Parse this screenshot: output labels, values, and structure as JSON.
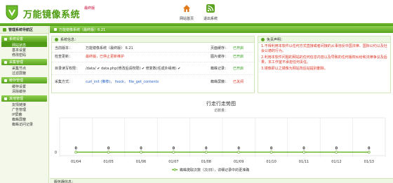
{
  "header": {
    "title": "万能镜像系统",
    "badge": "最终版",
    "nav": [
      {
        "label": "网站首页",
        "icon": "home-icon",
        "color": "#e07a1a"
      },
      {
        "label": "退出系统",
        "icon": "rss-icon",
        "color": "#5aa41f"
      }
    ]
  },
  "sidebar": {
    "title": "管理系统导航区",
    "sections": [
      {
        "title": "系统设置",
        "items": [
          "网站状态",
          "基本设置",
          "修改密码"
        ]
      },
      {
        "title": "采集管理",
        "items": [
          "采集节点",
          "过滤屏蔽"
        ]
      },
      {
        "title": "缓存管理",
        "items": [
          "缓存设置",
          "清除缓存"
        ]
      },
      {
        "title": "其他管理",
        "items": [
          "友情链接",
          "广告管理",
          "IP屏蔽",
          "蜘蛛屏蔽",
          "蜘蛛访问记录"
        ]
      }
    ],
    "active_item": "网站状态"
  },
  "breadcrumb": "万能镜像系统（最终版）6.21",
  "sysinfo": {
    "title": "系统信息：",
    "rows": [
      {
        "label": "当前版本：",
        "value": "万能镜像系统（最终版） 6.21",
        "label2": "页面缓存：",
        "status2": "已开启"
      },
      {
        "label": "检查更新：",
        "value": "最终版，已停止更新维护",
        "label2": "图片缓存：",
        "status2": "已开启"
      },
      {
        "label": "目录读写权限：",
        "value": "/data/ ✔   data.php(修改后请权限) ✔   修复数(任成外缘用) ✔",
        "label2": "蜘蛛记录：",
        "status2": "已开启"
      },
      {
        "label": "采集方式：",
        "value": "curl_init (推荐)， fsock， file_get_contents",
        "label2": "蜘蛛屏蔽：",
        "status2": "已关闭"
      }
    ]
  },
  "notice": {
    "title": "免责声明：",
    "lines": [
      "1.不得利用本软件以任何方式直接或者间接的从事违反中国法律、国际公约以及社会公德的行为。",
      "2.利用本软件问题的网站的任何信息内容以及导致的任何版权纠纷和法律争议及后果，本工作室不承担任何责任。",
      "3.镜像即以之镜像为网站背后站提别删除。"
    ]
  },
  "colors": {
    "accent": "#5aa41f",
    "line": "#6bb52f",
    "ok": "#2a9c16",
    "off": "#d32222"
  },
  "chart_data": {
    "type": "line",
    "title": "行走行走势图",
    "subtitle": "访数量：",
    "x": [
      "01/04",
      "01/05",
      "01/06",
      "01/07",
      "01/08",
      "01/09",
      "01/10",
      "01/11",
      "01/12",
      "01/13"
    ],
    "series": [
      {
        "name": "蜘蛛爬取次数（次/日），详细记录中的更准确",
        "values": [
          0,
          0,
          0,
          0,
          0,
          0,
          0,
          0,
          0,
          0
        ]
      }
    ],
    "yticks": [
      "0"
    ],
    "ylim": [
      0,
      1
    ],
    "grid": true,
    "legend": "bottom"
  },
  "bottom": {
    "title": "服务器信息："
  }
}
